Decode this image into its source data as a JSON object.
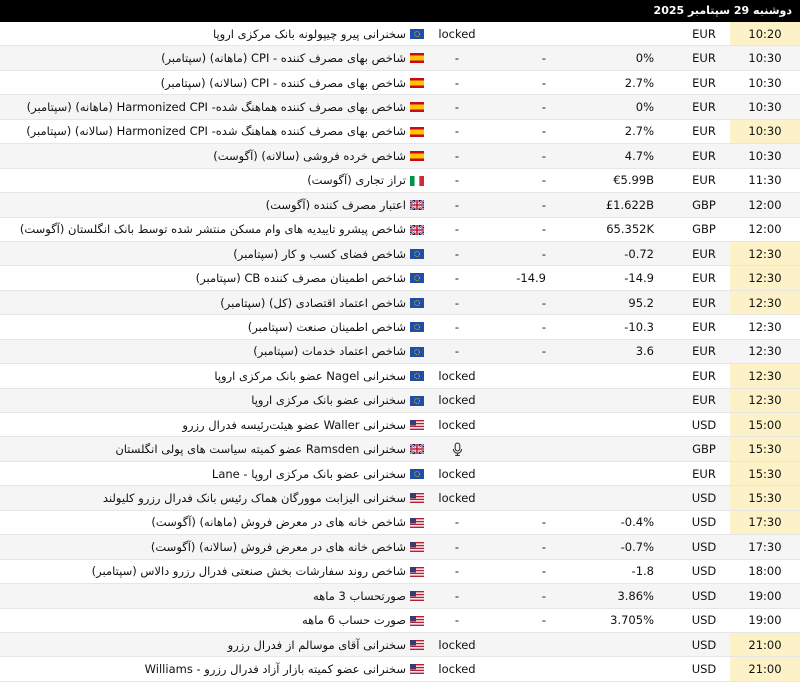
{
  "header": {
    "date": "دوشنبه 29 سپتامبر 2025"
  },
  "rows": [
    {
      "time": "10:20",
      "hl": true,
      "cur": "EUR",
      "actual": "",
      "forecast": "",
      "prev": "locked",
      "flag": "eu",
      "event": "سخنرانی پیرو چیپولونه بانک مرکزی اروپا"
    },
    {
      "time": "10:30",
      "hl": false,
      "cur": "EUR",
      "actual": "0%",
      "forecast": "-",
      "prev": "-",
      "flag": "es",
      "event": "شاخص بهای مصرف کننده - CPI (ماهانه) (سپتامبر)"
    },
    {
      "time": "10:30",
      "hl": false,
      "cur": "EUR",
      "actual": "2.7%",
      "forecast": "-",
      "prev": "-",
      "flag": "es",
      "event": "شاخص بهای مصرف کننده - CPI (سالانه) (سپتامبر)"
    },
    {
      "time": "10:30",
      "hl": false,
      "cur": "EUR",
      "actual": "0%",
      "forecast": "-",
      "prev": "-",
      "flag": "es",
      "event": "شاخص بهای مصرف کننده هماهنگ شده- Harmonized CPI (ماهانه) (سپتامبر)"
    },
    {
      "time": "10:30",
      "hl": true,
      "cur": "EUR",
      "actual": "2.7%",
      "forecast": "-",
      "prev": "-",
      "flag": "es",
      "event": "شاخص بهای مصرف کننده هماهنگ شده- Harmonized CPI (سالانه) (سپتامبر)"
    },
    {
      "time": "10:30",
      "hl": false,
      "cur": "EUR",
      "actual": "4.7%",
      "forecast": "-",
      "prev": "-",
      "flag": "es",
      "event": "شاخص خرده فروشی (سالانه) (آگوست)"
    },
    {
      "time": "11:30",
      "hl": false,
      "cur": "EUR",
      "actual": "€5.99B",
      "forecast": "-",
      "prev": "-",
      "flag": "it",
      "event": "تراز تجاری (آگوست)"
    },
    {
      "time": "12:00",
      "hl": false,
      "cur": "GBP",
      "actual": "£1.622B",
      "forecast": "-",
      "prev": "-",
      "flag": "gb",
      "event": "اعتبار مصرف کننده (آگوست)"
    },
    {
      "time": "12:00",
      "hl": false,
      "cur": "GBP",
      "actual": "65.352K",
      "forecast": "-",
      "prev": "-",
      "flag": "gb",
      "event": "شاخص پیشرو تاییدیه های وام مسکن منتشر شده توسط بانک انگلستان (آگوست)"
    },
    {
      "time": "12:30",
      "hl": true,
      "cur": "EUR",
      "actual": "-0.72",
      "forecast": "-",
      "prev": "-",
      "flag": "eu",
      "event": "شاخص فضای کسب و کار (سپتامبر)"
    },
    {
      "time": "12:30",
      "hl": true,
      "cur": "EUR",
      "actual": "-14.9",
      "forecast": "-14.9",
      "prev": "-",
      "flag": "eu",
      "event": "شاخص اطمینان مصرف کننده CB (سپتامبر)"
    },
    {
      "time": "12:30",
      "hl": true,
      "cur": "EUR",
      "actual": "95.2",
      "forecast": "-",
      "prev": "-",
      "flag": "eu",
      "event": "شاخص اعتماد اقتصادی (کل) (سپتامبر)"
    },
    {
      "time": "12:30",
      "hl": false,
      "cur": "EUR",
      "actual": "-10.3",
      "forecast": "-",
      "prev": "-",
      "flag": "eu",
      "event": "شاخص اطمینان صنعت (سپتامبر)"
    },
    {
      "time": "12:30",
      "hl": false,
      "cur": "EUR",
      "actual": "3.6",
      "forecast": "-",
      "prev": "-",
      "flag": "eu",
      "event": "شاخص اعتماد خدمات (سپتامبر)"
    },
    {
      "time": "12:30",
      "hl": true,
      "cur": "EUR",
      "actual": "",
      "forecast": "",
      "prev": "locked",
      "flag": "eu",
      "event": "سخنرانی Nagel عضو بانک مرکزی اروپا"
    },
    {
      "time": "12:30",
      "hl": true,
      "cur": "EUR",
      "actual": "",
      "forecast": "",
      "prev": "locked",
      "flag": "eu",
      "event": "سخنرانی عضو بانک مرکزی اروپا"
    },
    {
      "time": "15:00",
      "hl": true,
      "cur": "USD",
      "actual": "",
      "forecast": "",
      "prev": "locked",
      "flag": "us",
      "event": "سخنرانی Waller عضو هیئت‌رئیسه فدرال رزرو"
    },
    {
      "time": "15:30",
      "hl": true,
      "cur": "GBP",
      "actual": "",
      "forecast": "",
      "prev": "mic",
      "flag": "gb",
      "event": "سخنرانی Ramsden عضو کمیته سیاست های پولی انگلستان"
    },
    {
      "time": "15:30",
      "hl": true,
      "cur": "EUR",
      "actual": "",
      "forecast": "",
      "prev": "locked",
      "flag": "eu",
      "event": "سخنرانی عضو بانک مرکزی اروپا - Lane"
    },
    {
      "time": "15:30",
      "hl": true,
      "cur": "USD",
      "actual": "",
      "forecast": "",
      "prev": "locked",
      "flag": "us",
      "event": "سخنرانی الیزابت موورگان هماک رئیس بانک فدرال رزرو کلیولند"
    },
    {
      "time": "17:30",
      "hl": true,
      "cur": "USD",
      "actual": "-0.4%",
      "forecast": "-",
      "prev": "-",
      "flag": "us",
      "event": "شاخص خانه های در معرض فروش (ماهانه) (آگوست)"
    },
    {
      "time": "17:30",
      "hl": false,
      "cur": "USD",
      "actual": "-0.7%",
      "forecast": "-",
      "prev": "-",
      "flag": "us",
      "event": "شاخص خانه های در معرض فروش (سالانه) (آگوست)"
    },
    {
      "time": "18:00",
      "hl": false,
      "cur": "USD",
      "actual": "-1.8",
      "forecast": "-",
      "prev": "-",
      "flag": "us",
      "event": "شاخص روند سفارشات بخش صنعتی فدرال رزرو دالاس (سپتامبر)"
    },
    {
      "time": "19:00",
      "hl": false,
      "cur": "USD",
      "actual": "3.86%",
      "forecast": "-",
      "prev": "-",
      "flag": "us",
      "event": "صورتحساب 3 ماهه"
    },
    {
      "time": "19:00",
      "hl": false,
      "cur": "USD",
      "actual": "3.705%",
      "forecast": "-",
      "prev": "-",
      "flag": "us",
      "event": "صورت حساب 6 ماهه"
    },
    {
      "time": "21:00",
      "hl": true,
      "cur": "USD",
      "actual": "",
      "forecast": "",
      "prev": "locked",
      "flag": "us",
      "event": "سخنرانی آقای موسالم از فدرال رزرو"
    },
    {
      "time": "21:00",
      "hl": true,
      "cur": "USD",
      "actual": "",
      "forecast": "",
      "prev": "locked",
      "flag": "us",
      "event": "سخنرانی عضو کمیته بازار آزاد فدرال رزرو - Williams"
    }
  ]
}
